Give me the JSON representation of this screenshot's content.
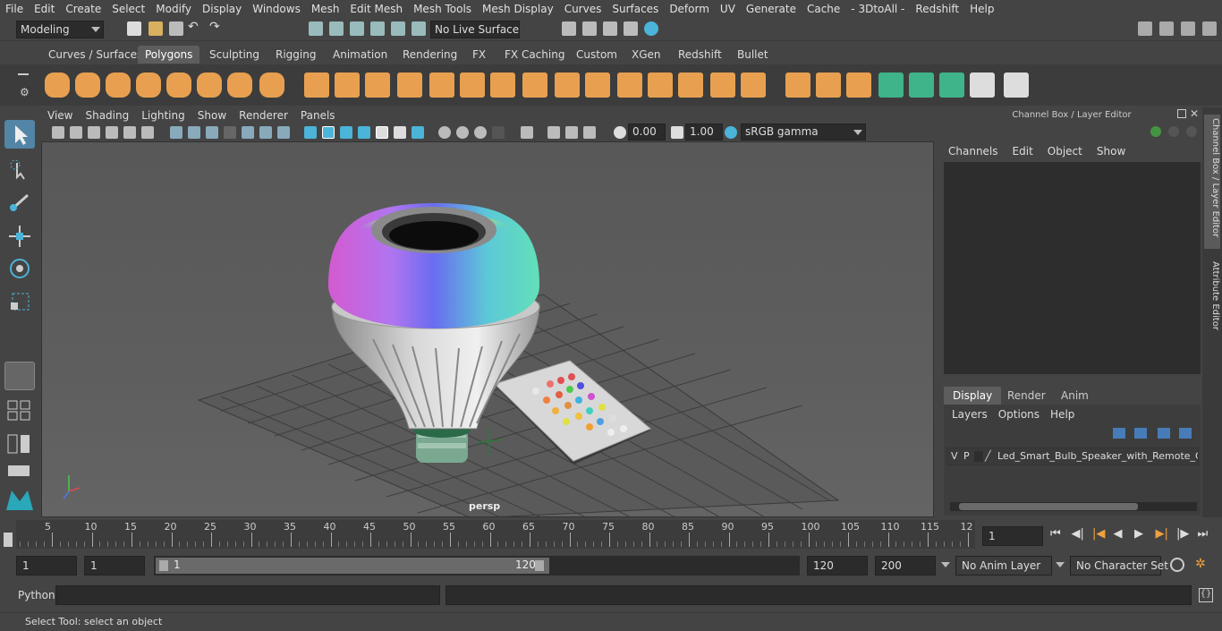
{
  "menubar": {
    "items": [
      "File",
      "Edit",
      "Create",
      "Select",
      "Modify",
      "Display",
      "Windows",
      "Mesh",
      "Edit Mesh",
      "Mesh Tools",
      "Mesh Display",
      "Curves",
      "Surfaces",
      "Deform",
      "UV",
      "Generate",
      "Cache",
      "- 3DtoAll -",
      "Redshift",
      "Help"
    ]
  },
  "status": {
    "mode": "Modeling",
    "live_surface": "No Live Surface"
  },
  "shelf": {
    "tabs": [
      "Curves / Surfaces",
      "Polygons",
      "Sculpting",
      "Rigging",
      "Animation",
      "Rendering",
      "FX",
      "FX Caching",
      "Custom",
      "XGen",
      "Redshift",
      "Bullet"
    ],
    "active_tab": "Polygons"
  },
  "viewport": {
    "menu": [
      "View",
      "Shading",
      "Lighting",
      "Show",
      "Renderer",
      "Panels"
    ],
    "exposure": "0.00",
    "gamma": "1.00",
    "color_space": "sRGB gamma",
    "camera_label": "persp"
  },
  "channel_box": {
    "title": "Channel Box / Layer Editor",
    "menu": [
      "Channels",
      "Edit",
      "Object",
      "Show"
    ]
  },
  "layer_editor": {
    "tabs": [
      "Display",
      "Render",
      "Anim"
    ],
    "active_tab": "Display",
    "menu": [
      "Layers",
      "Options",
      "Help"
    ],
    "layer": {
      "v": "V",
      "p": "P",
      "name": "Led_Smart_Bulb_Speaker_with_Remote_Cor"
    }
  },
  "side_tabs": [
    "Channel Box / Layer Editor",
    "Attribute Editor"
  ],
  "timeline": {
    "ticks": [
      "5",
      "10",
      "15",
      "20",
      "25",
      "30",
      "35",
      "40",
      "45",
      "50",
      "55",
      "60",
      "65",
      "70",
      "75",
      "80",
      "85",
      "90",
      "95",
      "100",
      "105",
      "110",
      "115",
      "12"
    ],
    "start_marker": "1",
    "current_frame": "1"
  },
  "range": {
    "start": "1",
    "playback_start": "1",
    "slider_start": "1",
    "slider_end": "120",
    "playback_end": "120",
    "end": "200",
    "anim_layer": "No Anim Layer",
    "character_set": "No Character Set"
  },
  "command": {
    "label": "Python"
  },
  "help": {
    "text": "Select Tool: select an object"
  },
  "colors": {
    "accent": "#5285a6",
    "shelf_icon": "#e8a050",
    "shelf_icon_green": "#3fb38a"
  }
}
